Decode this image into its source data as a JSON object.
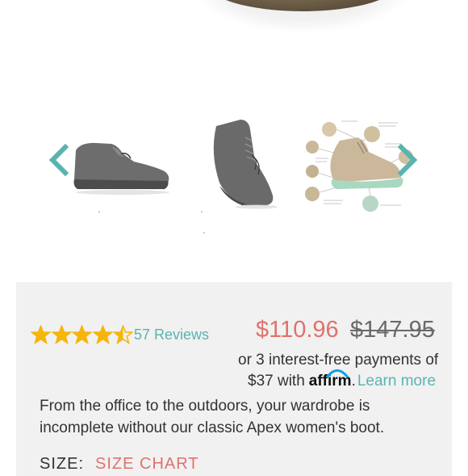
{
  "gallery": {
    "prev_icon": "chevron-left-icon",
    "next_icon": "chevron-right-icon",
    "accent_color": "#5bb3b1"
  },
  "product": {
    "rating": 4.5,
    "rating_max": 5,
    "reviews_label": "57 Reviews",
    "price_sale": "$110.96",
    "price_original": "$147.95",
    "installments_text": "or 3 interest-free payments of",
    "installment_amount_text": "$37 with",
    "affirm_logo": "affirm",
    "learn_more_label": "Learn more",
    "description": "From the office to the outdoors, your wardrobe is incomplete without our classic Apex women's boot.",
    "size_label": "SIZE:",
    "size_chart_label": "SIZE CHART"
  },
  "colors": {
    "sale_price": "#e0726b",
    "link": "#5bb3b1",
    "star": "#f5b50a",
    "panel_bg": "#f1f1f1"
  }
}
